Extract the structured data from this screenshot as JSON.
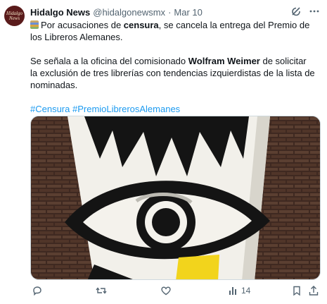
{
  "author": {
    "name": "Hidalgo News",
    "handle": "@hidalgonewsmx",
    "date": "Mar 10",
    "avatar_text": [
      "Hidalgo",
      "News"
    ]
  },
  "tweet": {
    "p1_before": "Por acusaciones de ",
    "p1_bold": "censura",
    "p1_after": ", se cancela la entrega del Premio de los Libreros Alemanes.",
    "p2_before": "Se señala a la oficina del comisionado ",
    "p2_bold": "Wolfram Weimer",
    "p2_after": " de solicitar la exclusión de tres librerías con tendencias izquierdistas de la lista de nominadas.",
    "hashtags": [
      "#Censura",
      "#PremioLibrerosAlemanes"
    ]
  },
  "icons": {
    "emoji": "books-emoji",
    "grok": "grok-icon",
    "more": "more-icon",
    "reply": "reply-icon",
    "retweet": "retweet-icon",
    "like": "like-icon",
    "views": "views-icon",
    "bookmark": "bookmark-icon",
    "share": "share-icon"
  },
  "stats": {
    "views": "14"
  },
  "colors": {
    "link": "#1d9bf0",
    "secondary": "#536471"
  }
}
